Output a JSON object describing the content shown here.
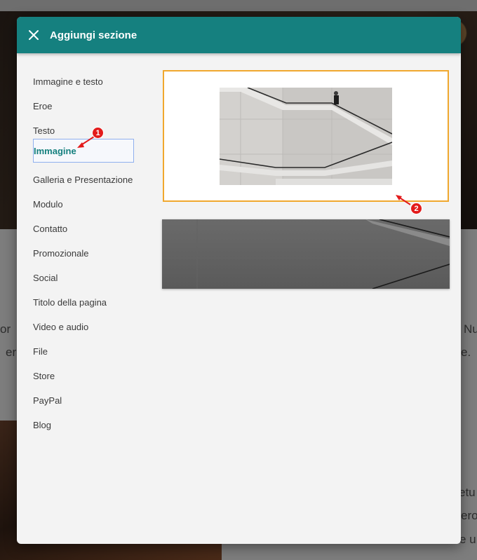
{
  "background": {
    "text_left_1": "or",
    "text_left_2": "er",
    "text_right_1": "Nu",
    "text_right_2": "e.",
    "text_right_3": "etu",
    "text_right_4": "ero",
    "text_right_5": "e u"
  },
  "dialog": {
    "title": "Aggiungi sezione",
    "close_icon": "close-icon"
  },
  "sections": [
    {
      "label": "Immagine e testo"
    },
    {
      "label": "Eroe"
    },
    {
      "label": "Testo"
    },
    {
      "label": "Immagine",
      "selected": true
    },
    {
      "label": "Galleria e Presentazione"
    },
    {
      "label": "Modulo"
    },
    {
      "label": "Contatto"
    },
    {
      "label": "Promozionale"
    },
    {
      "label": "Social"
    },
    {
      "label": "Titolo della pagina"
    },
    {
      "label": "Video e audio"
    },
    {
      "label": "File"
    },
    {
      "label": "Store"
    },
    {
      "label": "PayPal"
    },
    {
      "label": "Blog"
    }
  ],
  "annotations": {
    "marker_1": "1",
    "marker_2": "2"
  },
  "colors": {
    "header": "#15807f",
    "selected_text": "#15807f",
    "selected_border": "#8fb0ee",
    "card_highlight": "#f0a82e",
    "marker": "#e31b1b"
  }
}
